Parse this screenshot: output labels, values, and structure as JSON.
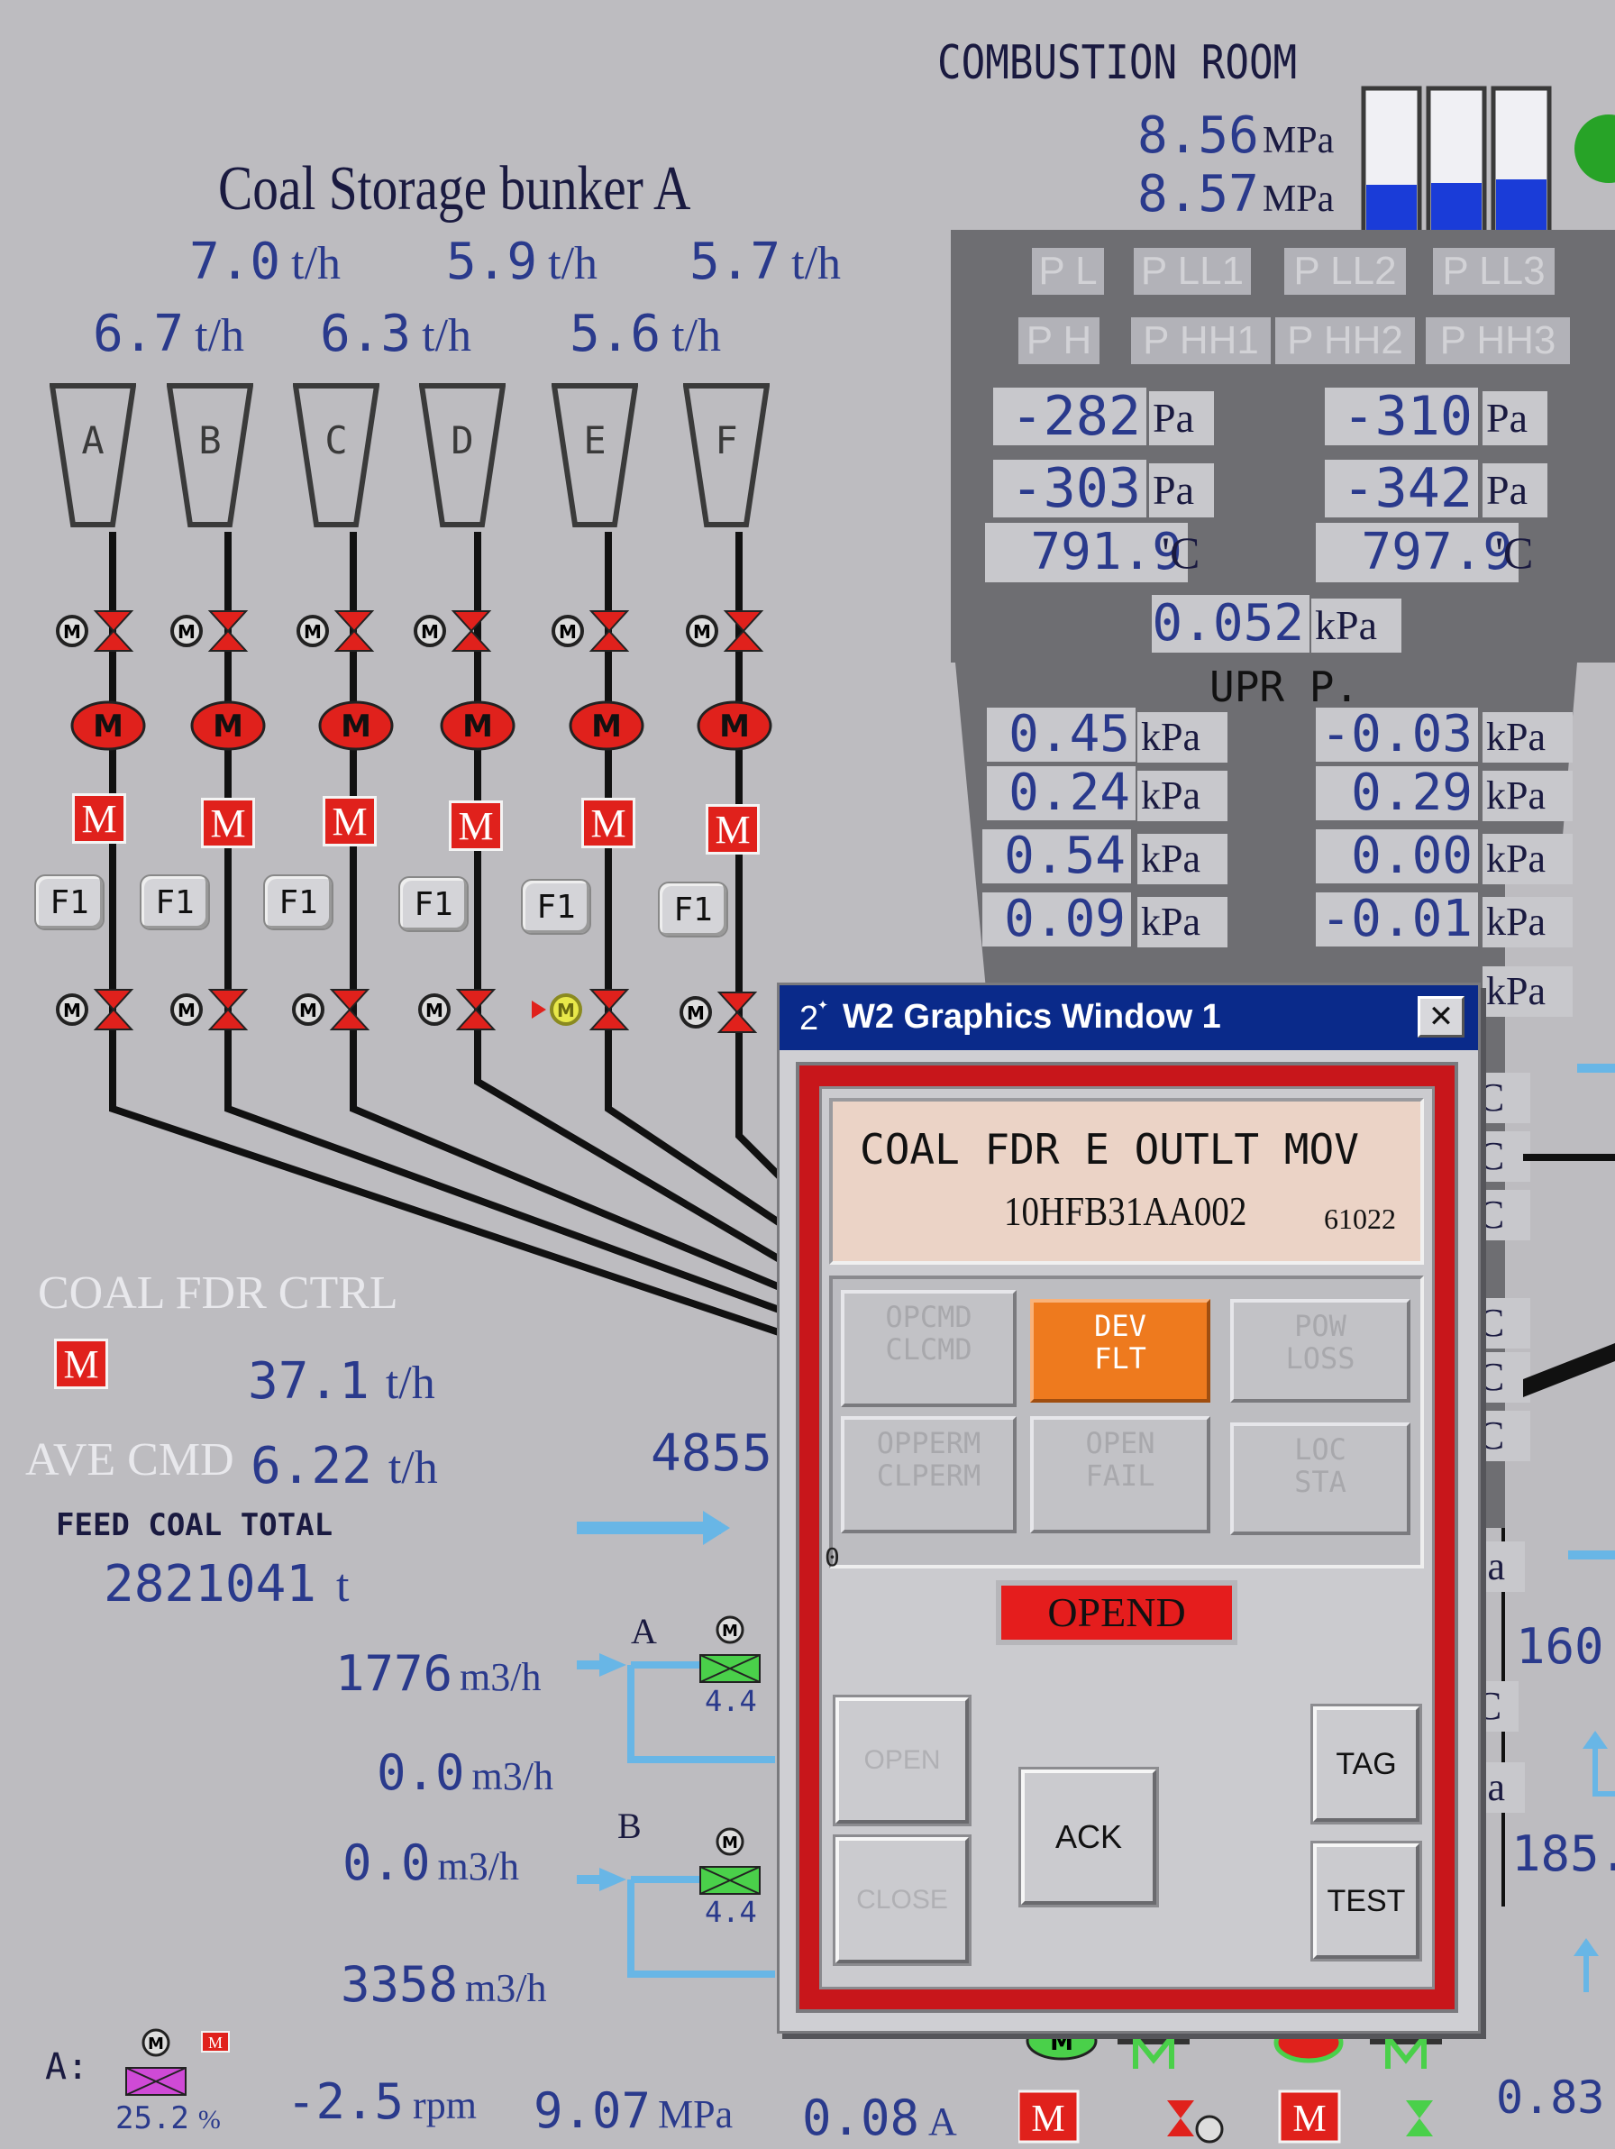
{
  "bunker": {
    "title": "Coal Storage bunker A",
    "flows_row1": [
      {
        "v": "7.0",
        "u": "t/h"
      },
      {
        "v": "5.9",
        "u": "t/h"
      },
      {
        "v": "5.7",
        "u": "t/h"
      }
    ],
    "flows_row2": [
      {
        "v": "6.7",
        "u": "t/h"
      },
      {
        "v": "6.3",
        "u": "t/h"
      },
      {
        "v": "5.6",
        "u": "t/h"
      }
    ],
    "feeders": [
      "A",
      "B",
      "C",
      "D",
      "E",
      "F"
    ],
    "m_label": "M",
    "f1_label": "F1"
  },
  "combustion": {
    "title": "COMBUSTION ROOM",
    "pressure1": "8.56",
    "pressure2": "8.57",
    "pressure_unit": "MPa",
    "alarms_row1": [
      "P L",
      "P LL1",
      "P LL2",
      "P LL3"
    ],
    "alarms_row2": [
      "P H",
      "P HH1",
      "P HH2",
      "P HH3"
    ],
    "left_vals": [
      {
        "v": "-282",
        "u": "Pa"
      },
      {
        "v": "-303",
        "u": "Pa"
      },
      {
        "v": "791.9",
        "u": "'C"
      }
    ],
    "right_vals": [
      {
        "v": "-310",
        "u": "Pa"
      },
      {
        "v": "-342",
        "u": "Pa"
      },
      {
        "v": "797.9",
        "u": "'C"
      }
    ],
    "center_val": {
      "v": "0.052",
      "u": "kPa"
    },
    "upr_label": "UPR P.",
    "upr_left": [
      {
        "v": "0.45",
        "u": "kPa"
      },
      {
        "v": "0.24",
        "u": "kPa"
      },
      {
        "v": "0.54",
        "u": "kPa"
      },
      {
        "v": "0.09",
        "u": "kPa"
      }
    ],
    "upr_right": [
      {
        "v": "-0.03",
        "u": "kPa"
      },
      {
        "v": "0.29",
        "u": "kPa"
      },
      {
        "v": "0.00",
        "u": "kPa"
      },
      {
        "v": "-0.01",
        "u": "kPa"
      }
    ],
    "right_partial_c": "'C",
    "right_partial_pa": "Pa",
    "right_partial_kpa": "kPa",
    "right_val_160": "160.",
    "right_val_185": "185."
  },
  "ctrl": {
    "title": "COAL FDR CTRL",
    "m_label": "M",
    "total_flow": "37.1",
    "total_flow_unit": "t/h",
    "ave_cmd_label": "AVE CMD",
    "ave_cmd": "6.22",
    "ave_cmd_unit": "t/h",
    "feed_total_label": "FEED COAL TOTAL",
    "feed_total": "2821041",
    "feed_total_unit": "t",
    "partial_4855": "4855",
    "air_a_label": "A",
    "air_b_label": "B",
    "flow1": "1776",
    "flow2": "0.0",
    "flow3": "0.0",
    "flow4": "3358",
    "flow_unit": "m3/h",
    "valve_pct_a": "4.4",
    "valve_pct_b": "4.4",
    "bottom_label": "A:",
    "bottom_pct": "25.2",
    "bottom_pct_unit": "%",
    "bottom_rpm": "-2.5",
    "bottom_rpm_unit": "rpm",
    "bottom_mpa": "9.07",
    "bottom_mpa_unit": "MPa",
    "bottom_a": "0.08",
    "bottom_a_unit": "A",
    "bottom_right": "0.83"
  },
  "popup": {
    "window_num": "2",
    "title": "W2 Graphics Window 1",
    "close": "✕",
    "device_name": "COAL FDR E OUTLT MOV",
    "device_tag": "10HFB31AA002",
    "device_id": "61022",
    "status": [
      {
        "l1": "OPCMD",
        "l2": "CLCMD",
        "active": false
      },
      {
        "l1": "DEV",
        "l2": "FLT",
        "active": true
      },
      {
        "l1": "POW",
        "l2": "LOSS",
        "active": false
      },
      {
        "l1": "OPPERM",
        "l2": "CLPERM",
        "active": false
      },
      {
        "l1": "OPEN",
        "l2": "FAIL",
        "active": false
      },
      {
        "l1": "LOC",
        "l2": "STA",
        "active": false
      }
    ],
    "zero": "0",
    "state": "OPEND",
    "btn_open": "OPEN",
    "btn_close": "CLOSE",
    "btn_ack": "ACK",
    "btn_tag": "TAG",
    "btn_test": "TEST",
    "colors": {
      "frame": "#c8161b",
      "dev_flt": "#ee7a1e",
      "state": "#e51d1d",
      "title_bar": "#0a2a8a"
    }
  }
}
